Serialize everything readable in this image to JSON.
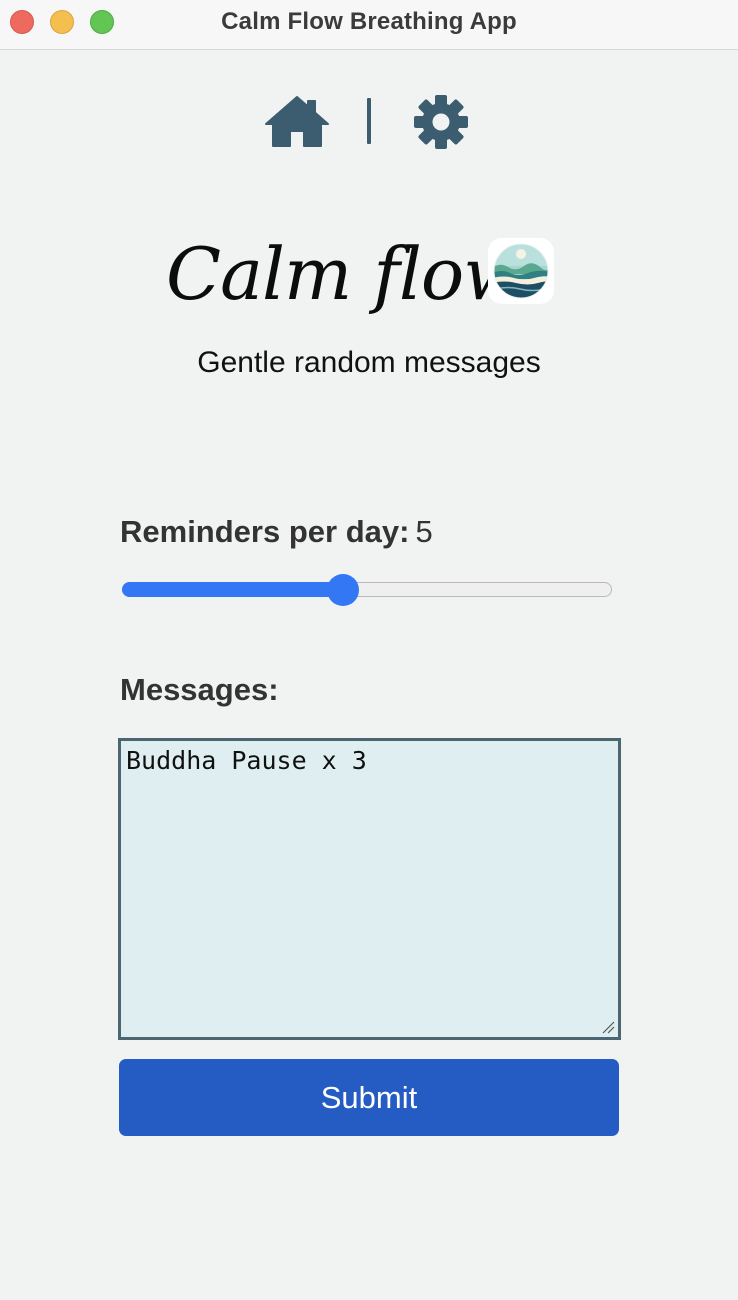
{
  "window": {
    "title": "Calm Flow Breathing App"
  },
  "nav": {
    "home_icon": "home-icon",
    "settings_icon": "gear-icon"
  },
  "brand": {
    "title": "Calm flow",
    "subtitle": "Gentle random messages"
  },
  "reminders": {
    "label": "Reminders per day:",
    "value": "5",
    "slider_fraction": 0.45
  },
  "messages": {
    "label": "Messages:",
    "text": "Buddha Pause x 3"
  },
  "submit": {
    "label": "Submit"
  },
  "colors": {
    "accent": "#3477f5",
    "button": "#255cc3",
    "nav_icon": "#3c5c6f",
    "textarea_bg": "#dfeff1",
    "page_bg": "#f1f3f2"
  }
}
